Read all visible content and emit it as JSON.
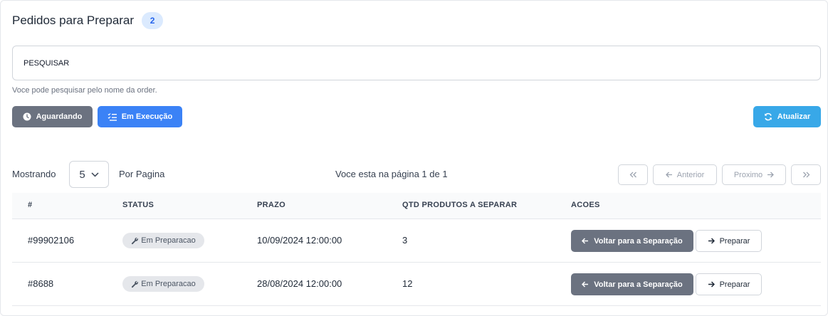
{
  "header": {
    "title": "Pedidos para Preparar",
    "count": "2"
  },
  "search": {
    "placeholder": "PESQUISAR",
    "value": "",
    "hint": "Voce pode pesquisar pelo nome da order."
  },
  "filters": {
    "waiting_label": "Aguardando",
    "executing_label": "Em Execução"
  },
  "actions": {
    "refresh_label": "Atualizar"
  },
  "pagination": {
    "showing_label": "Mostrando",
    "per_page_value": "5",
    "per_page_label": "Por Pagina",
    "page_info": "Voce esta na página 1 de 1",
    "prev_label": "Anterior",
    "next_label": "Proximo"
  },
  "table": {
    "columns": [
      "#",
      "STATUS",
      "PRAZO",
      "QTD PRODUTOS A SEPARAR",
      "ACOES"
    ],
    "rows": [
      {
        "id": "#99902106",
        "status": "Em Preparacao",
        "deadline": "10/09/2024 12:00:00",
        "qty": "3",
        "back_label": "Voltar para a Separação",
        "prepare_label": "Preparar"
      },
      {
        "id": "#8688",
        "status": "Em Preparacao",
        "deadline": "28/08/2024 12:00:00",
        "qty": "12",
        "back_label": "Voltar para a Separação",
        "prepare_label": "Preparar"
      }
    ]
  },
  "icons": {
    "waiting": "clock-icon",
    "executing": "list-check-icon",
    "refresh": "refresh-icon",
    "status": "wrench-icon",
    "back": "arrow-left-icon",
    "prepare": "arrow-right-icon",
    "first": "double-chevron-left-icon",
    "last": "double-chevron-right-icon",
    "select": "chevron-down-icon"
  },
  "colors": {
    "grey_button": "#6b7280",
    "blue_button": "#3b82f6",
    "refresh_button": "#38a8e8",
    "badge_bg": "#dbeafe",
    "badge_text": "#2563eb"
  }
}
